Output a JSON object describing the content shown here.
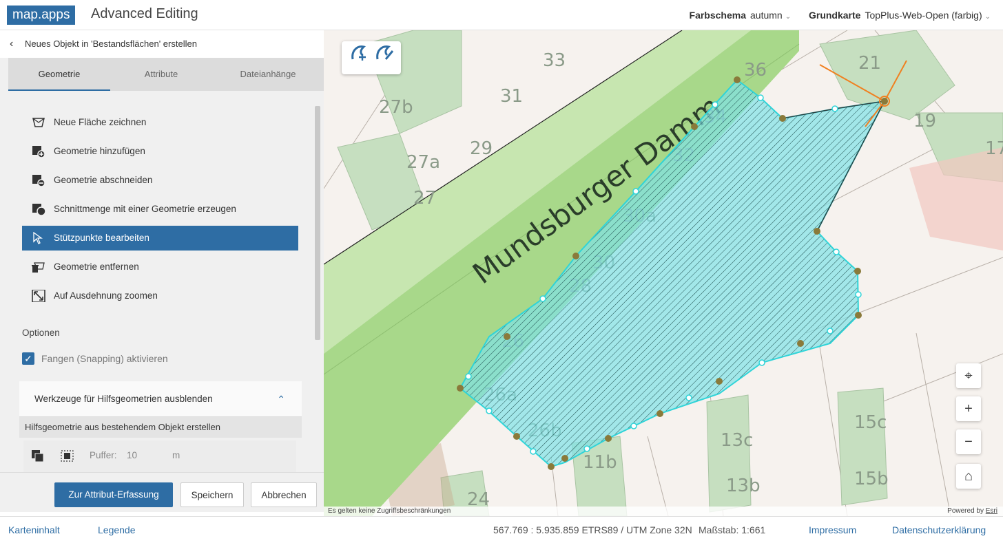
{
  "header": {
    "brand": "map.apps",
    "title": "Advanced Editing",
    "farbschema_label": "Farbschema",
    "farbschema_value": "autumn",
    "grundkarte_label": "Grundkarte",
    "grundkarte_value": "TopPlus-Web-Open (farbig)"
  },
  "panel": {
    "back_label": "Neues Objekt in 'Bestandsflächen' erstellen",
    "tabs": [
      {
        "label": "Geometrie",
        "active": true
      },
      {
        "label": "Attribute",
        "active": false
      },
      {
        "label": "Dateianhänge",
        "active": false
      }
    ],
    "tools": [
      {
        "label": "Neue Fläche zeichnen",
        "icon": "draw-polygon-icon",
        "active": false
      },
      {
        "label": "Geometrie hinzufügen",
        "icon": "add-geometry-icon",
        "active": false
      },
      {
        "label": "Geometrie abschneiden",
        "icon": "cut-geometry-icon",
        "active": false
      },
      {
        "label": "Schnittmenge mit einer Geometrie erzeugen",
        "icon": "intersect-icon",
        "active": false
      },
      {
        "label": "Stützpunkte bearbeiten",
        "icon": "edit-vertices-icon",
        "active": true
      },
      {
        "label": "Geometrie entfernen",
        "icon": "delete-geometry-icon",
        "active": false
      },
      {
        "label": "Auf Ausdehnung zoomen",
        "icon": "zoom-extent-icon",
        "active": false
      }
    ],
    "options_heading": "Optionen",
    "snapping_label": "Fangen (Snapping) aktivieren",
    "snapping_checked": true,
    "helper_label": "Werkzeuge für Hilfsgeometrien ausblenden",
    "helper_sub_label": "Hilfsgeometrie aus bestehendem Objekt erstellen",
    "buffer_label": "Puffer:",
    "buffer_value": "10",
    "buffer_unit": "m",
    "buttons": {
      "attribute": "Zur Attribut-Erfassung",
      "save": "Speichern",
      "cancel": "Abbrechen"
    }
  },
  "map": {
    "street_name": "Mundsburger Damm",
    "parcel_labels": [
      "27b",
      "27a",
      "27",
      "29",
      "31",
      "33",
      "36",
      "21",
      "19",
      "17",
      "26a",
      "26b",
      "26",
      "28",
      "30",
      "30a",
      "32",
      "34",
      "11b",
      "13c",
      "13b",
      "15c",
      "15b",
      "24"
    ],
    "attribution_left": "Es gelten keine Zugriffsbeschränkungen",
    "attribution_powered": "Powered by",
    "attribution_esri": "Esri",
    "colors": {
      "street_green": "#a8d88a",
      "building_green": "#c6dfc0",
      "polygon_fill": "#7fe3e8",
      "polygon_outline": "#2fd4d8",
      "vertex": "#8a7a3a",
      "accent": "#2e6da4"
    }
  },
  "footer": {
    "karteninhalt": "Karteninhalt",
    "legende": "Legende",
    "coords": "567.769 : 5.935.859",
    "crs": "ETRS89 / UTM Zone 32N",
    "scale": "Maßstab: 1:661",
    "impressum": "Impressum",
    "datenschutz": "Datenschutzerklärung"
  }
}
